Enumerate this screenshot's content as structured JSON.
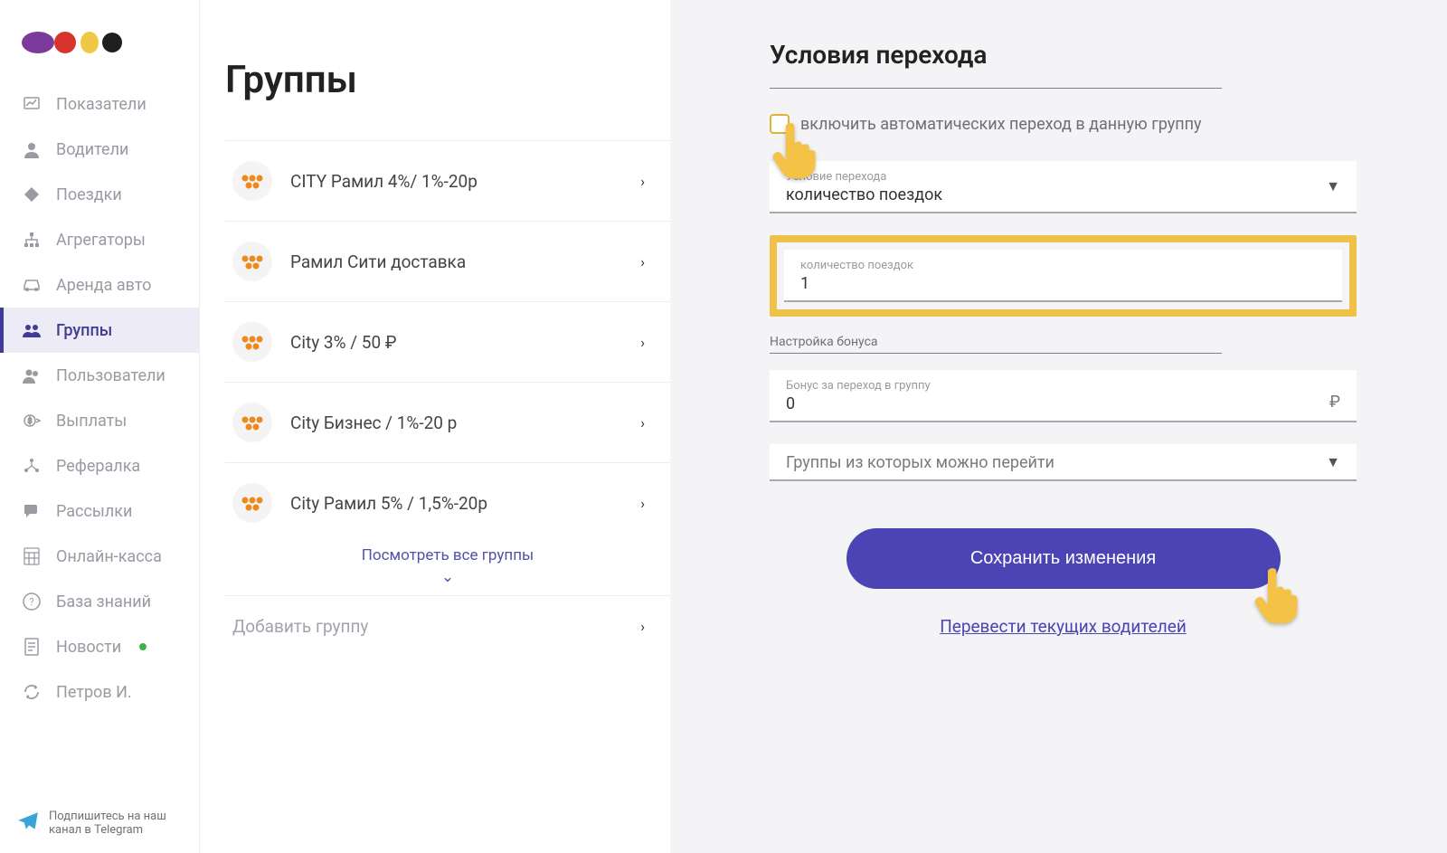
{
  "sidebar": {
    "items": [
      {
        "label": "Показатели"
      },
      {
        "label": "Водители"
      },
      {
        "label": "Поездки"
      },
      {
        "label": "Агрегаторы"
      },
      {
        "label": "Аренда авто"
      },
      {
        "label": "Группы"
      },
      {
        "label": "Пользователи"
      },
      {
        "label": "Выплаты"
      },
      {
        "label": "Рефералка"
      },
      {
        "label": "Рассылки"
      },
      {
        "label": "Онлайн-касса"
      },
      {
        "label": "База знаний"
      },
      {
        "label": "Новости"
      },
      {
        "label": "Петров И."
      }
    ],
    "telegram_promo": "Подпишитесь на наш канал в Telegram"
  },
  "middle": {
    "title": "Группы",
    "groups": [
      {
        "label": "CITY Рамил 4%/ 1%-20р"
      },
      {
        "label": "Рамил Сити доставка"
      },
      {
        "label": "City 3% / 50 ₽"
      },
      {
        "label": "City Бизнес / 1%-20 р"
      },
      {
        "label": "City Рамил 5% / 1,5%-20р"
      }
    ],
    "see_all": "Посмотреть все группы",
    "add_group": "Добавить группу"
  },
  "right": {
    "title": "Условия перехода",
    "checkbox_label": "включить автоматических переход в данную группу",
    "condition_field": {
      "label": "Условие перехода",
      "value": "количество поездок"
    },
    "count_field": {
      "label": "количество поездок",
      "value": "1"
    },
    "bonus_section": "Настройка бонуса",
    "bonus_field": {
      "label": "Бонус за переход в группу",
      "value": "0",
      "currency": "₽"
    },
    "from_groups_field": {
      "label": "",
      "value": "Группы из которых можно перейти"
    },
    "save_button": "Сохранить изменения",
    "transfer_link": "Перевести текущих водителей"
  }
}
